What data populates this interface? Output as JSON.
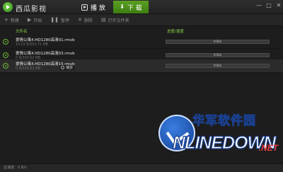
{
  "app": {
    "title": "西瓜影视"
  },
  "nav": {
    "play_label": "播 放",
    "download_label": "下 载"
  },
  "window": {
    "minimize": "—",
    "maximize": "□",
    "close": "✕"
  },
  "toolbar": {
    "items": [
      {
        "label": "新建",
        "icon": "plus-icon"
      },
      {
        "label": "开始",
        "icon": "play-icon"
      },
      {
        "label": "暂停",
        "icon": "pause-icon"
      },
      {
        "label": "删除",
        "icon": "close-icon"
      },
      {
        "label": "打开文件夹",
        "icon": "folder-icon"
      }
    ]
  },
  "columns": {
    "name": "文件名",
    "progress": "进度/速度"
  },
  "rows": [
    {
      "name": "爱情公寓4.HD1280高清01.rmvb",
      "size": "10.03 B/353.71 MB",
      "progress_text": "0 B/s",
      "progress": 0.0
    },
    {
      "name": "爱情公寓4.HD1280高清03.rmvb",
      "size": "0 B/399.93 MB",
      "progress_text": "0 B/s",
      "progress": 0.0
    },
    {
      "name": "爱情公寓4.HD1280高清15.rmvb",
      "size": "0 B/336.83 MB",
      "progress_text": "0 B/s",
      "progress": 0.0
    }
  ],
  "tooltip": {
    "label": "播放"
  },
  "watermark": {
    "cn": "华军软件园",
    "en": "NLINEDOWN",
    "net": ".NET"
  },
  "status": {
    "text": "总速度：0 B/s"
  },
  "colors": {
    "accent": "#5aa022",
    "background": "#1d1d1d"
  }
}
